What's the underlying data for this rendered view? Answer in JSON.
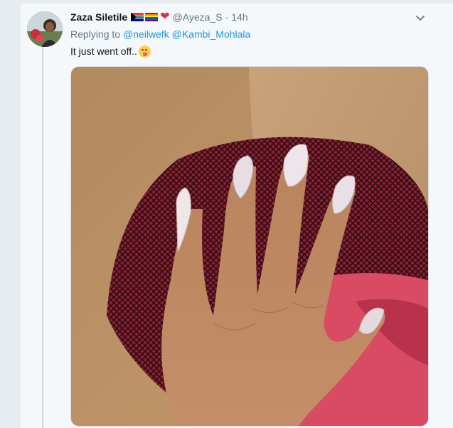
{
  "tweet": {
    "display_name": "Zaza Siletile",
    "name_emojis": [
      "south-africa-flag",
      "rainbow-flag",
      "red-heart"
    ],
    "handle": "@Ayeza_S",
    "separator": "·",
    "time": "14h",
    "replying_label": "Replying to",
    "reply_mentions": [
      "@neilwefk",
      "@Kambi_Mohlala"
    ],
    "text": "It just went off..",
    "text_emoji": "face-savoring-food",
    "media": {
      "type": "photo",
      "description_icon": "photo-image"
    }
  },
  "colors": {
    "background": "#e6ecf0",
    "card": "#f5f8fa",
    "link": "#1b95e0",
    "secondary_text": "#657786",
    "primary_text": "#14171a"
  }
}
